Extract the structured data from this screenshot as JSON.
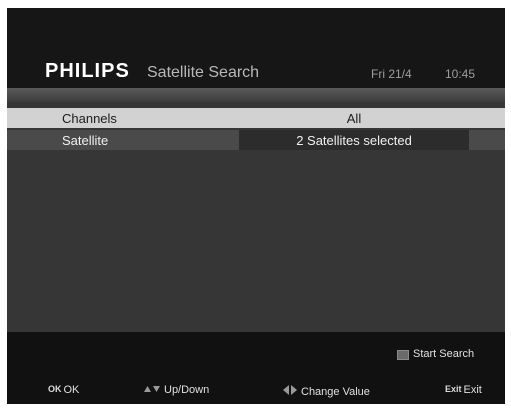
{
  "header": {
    "brand": "PHILIPS",
    "title": "Satellite Search",
    "date": "Fri 21/4",
    "time": "10:45"
  },
  "rows": [
    {
      "label": "Channels",
      "value": "All",
      "selected": true
    },
    {
      "label": "Satellite",
      "value": "2 Satellites selected",
      "selected": false
    }
  ],
  "footer": {
    "start_search": "Start Search",
    "ok_key": "OK",
    "ok_label": "OK",
    "updown_label": "Up/Down",
    "change_label": "Change Value",
    "exit_key": "Exit",
    "exit_label": "Exit"
  },
  "colors": {
    "selected_row": "#d2d2d2",
    "background": "#111111"
  },
  "icons": {
    "updown": "up-down-arrows-icon",
    "leftright": "left-right-arrows-icon",
    "start_key": "colour-key-icon"
  }
}
